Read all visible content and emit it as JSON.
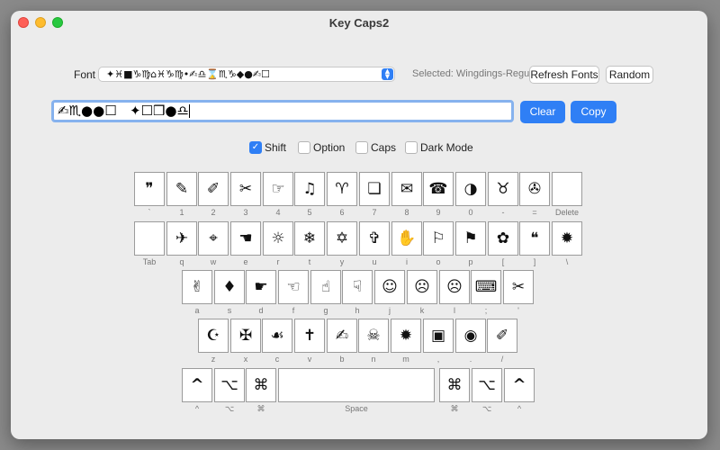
{
  "window": {
    "title": "Key Caps2"
  },
  "font_row": {
    "label": "Font",
    "selected_value": "✦♓■♑♍⌂♓♑♍•✍♎⌛♏♑◆●✍☐",
    "selected_label": "Selected: Wingdings-Regular",
    "refresh_label": "Refresh Fonts",
    "random_label": "Random"
  },
  "text_row": {
    "value": "✍♏●●☐   ✦☐❒●♎",
    "clear_label": "Clear",
    "copy_label": "Copy"
  },
  "options": [
    {
      "label": "Shift",
      "checked": true
    },
    {
      "label": "Option",
      "checked": false
    },
    {
      "label": "Caps",
      "checked": false
    },
    {
      "label": "Dark Mode",
      "checked": false
    }
  ],
  "rows": [
    {
      "keys": [
        {
          "glyph": "❞",
          "sub": "`"
        },
        {
          "glyph": "✎",
          "sub": "1"
        },
        {
          "glyph": "✐",
          "sub": "2"
        },
        {
          "glyph": "✂",
          "sub": "3"
        },
        {
          "glyph": "☞",
          "sub": "4"
        },
        {
          "glyph": "♫",
          "sub": "5"
        },
        {
          "glyph": "♈",
          "sub": "6"
        },
        {
          "glyph": "❏",
          "sub": "7"
        },
        {
          "glyph": "✉",
          "sub": "8"
        },
        {
          "glyph": "☎",
          "sub": "9"
        },
        {
          "glyph": "◑",
          "sub": "0"
        },
        {
          "glyph": "♉",
          "sub": "-"
        },
        {
          "glyph": "✇",
          "sub": "="
        },
        {
          "glyph": "",
          "sub": "Delete"
        }
      ]
    },
    {
      "keys": [
        {
          "glyph": "",
          "sub": "Tab"
        },
        {
          "glyph": "✈",
          "sub": "q"
        },
        {
          "glyph": "⌖",
          "sub": "w"
        },
        {
          "glyph": "☚",
          "sub": "e"
        },
        {
          "glyph": "☼",
          "sub": "r"
        },
        {
          "glyph": "❄",
          "sub": "t"
        },
        {
          "glyph": "✡",
          "sub": "y"
        },
        {
          "glyph": "✞",
          "sub": "u"
        },
        {
          "glyph": "✋",
          "sub": "i"
        },
        {
          "glyph": "⚐",
          "sub": "o"
        },
        {
          "glyph": "⚑",
          "sub": "p"
        },
        {
          "glyph": "✿",
          "sub": "["
        },
        {
          "glyph": "❝",
          "sub": "]"
        },
        {
          "glyph": "✹",
          "sub": "\\"
        }
      ]
    },
    {
      "keys": [
        {
          "glyph": "✌",
          "sub": "a"
        },
        {
          "glyph": "♦",
          "sub": "s"
        },
        {
          "glyph": "☛",
          "sub": "d"
        },
        {
          "glyph": "☜",
          "sub": "f"
        },
        {
          "glyph": "☝",
          "sub": "g"
        },
        {
          "glyph": "☟",
          "sub": "h"
        },
        {
          "glyph": "☺",
          "sub": "j"
        },
        {
          "glyph": "☹",
          "sub": "k"
        },
        {
          "glyph": "☹",
          "sub": "l"
        },
        {
          "glyph": "⌨",
          "sub": ";"
        },
        {
          "glyph": "✂",
          "sub": "'"
        }
      ]
    },
    {
      "keys": [
        {
          "glyph": "☪",
          "sub": "z"
        },
        {
          "glyph": "✠",
          "sub": "x"
        },
        {
          "glyph": "☙",
          "sub": "c"
        },
        {
          "glyph": "✝",
          "sub": "v"
        },
        {
          "glyph": "✍",
          "sub": "b"
        },
        {
          "glyph": "☠",
          "sub": "n"
        },
        {
          "glyph": "✹",
          "sub": "m"
        },
        {
          "glyph": "▣",
          "sub": ","
        },
        {
          "glyph": "◉",
          "sub": "."
        },
        {
          "glyph": "✐",
          "sub": "/"
        }
      ]
    },
    {
      "keys": [
        {
          "glyph": "^",
          "sub": "^"
        },
        {
          "glyph": "⌥",
          "sub": "⌥"
        },
        {
          "glyph": "⌘",
          "sub": "⌘"
        },
        {
          "glyph": "",
          "sub": "Space"
        },
        {
          "glyph": "⌘",
          "sub": "⌘"
        },
        {
          "glyph": "⌥",
          "sub": "⌥"
        },
        {
          "glyph": "^",
          "sub": "^"
        }
      ]
    }
  ]
}
